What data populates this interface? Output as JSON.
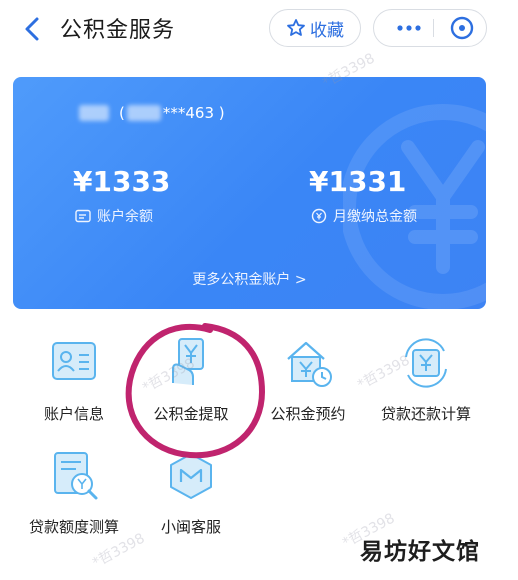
{
  "header": {
    "title": "公积金服务",
    "favorite_label": "收藏"
  },
  "account_card": {
    "masked_account": "***463 )",
    "balance_amount": "¥1333",
    "balance_label": "账户余额",
    "monthly_amount": "¥1331",
    "monthly_label": "月缴纳总金额",
    "more_accounts_label": "更多公积金账户 >"
  },
  "services": [
    {
      "label": "账户信息",
      "icon": "account-info-icon"
    },
    {
      "label": "公积金提取",
      "icon": "withdraw-icon"
    },
    {
      "label": "公积金预约",
      "icon": "appointment-icon"
    },
    {
      "label": "贷款还款计算",
      "icon": "loan-calc-icon"
    },
    {
      "label": "贷款额度测算",
      "icon": "loan-quota-icon"
    },
    {
      "label": "小闽客服",
      "icon": "customer-service-icon"
    }
  ],
  "watermarks": {
    "id_mark": "*哲3398",
    "brand": "易坊好文馆"
  },
  "colors": {
    "accent": "#2d6fe0",
    "card_blue": "#3a86f6",
    "icon_blue": "#5ab4ee",
    "annotation_circle": "#c0246e"
  }
}
